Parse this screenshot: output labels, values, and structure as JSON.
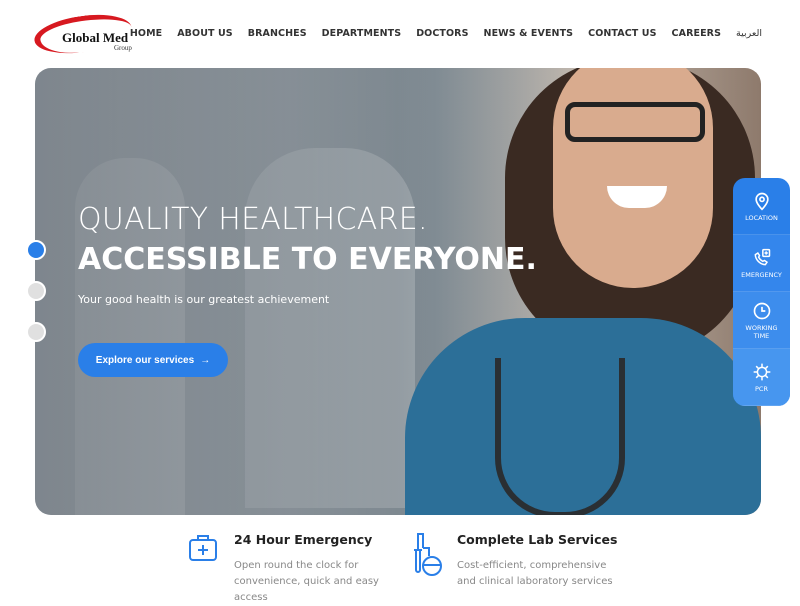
{
  "logo": {
    "name": "Global Med",
    "sub": "Group"
  },
  "nav": [
    "HOME",
    "ABOUT US",
    "BRANCHES",
    "DEPARTMENTS",
    "DOCTORS",
    "NEWS & EVENTS",
    "CONTACT US",
    "CAREERS",
    "العربية"
  ],
  "hero": {
    "line1": "QUALITY HEALTHCARE.",
    "line2": "ACCESSIBLE TO EVERYONE.",
    "subtitle": "Your good health is our greatest achievement",
    "cta": "Explore our services",
    "cta_icon": "→",
    "active_slide": 1,
    "slides": 3
  },
  "side": [
    {
      "icon": "location-pin",
      "label": "LOCATION"
    },
    {
      "icon": "phone-plus",
      "label": "EMERGENCY"
    },
    {
      "icon": "clock",
      "label": "WORKING TIME"
    },
    {
      "icon": "virus",
      "label": "PCR"
    }
  ],
  "features": [
    {
      "icon": "first-aid-kit",
      "title": "24 Hour Emergency",
      "text": "Open round the clock for convenience, quick and easy access"
    },
    {
      "icon": "lab-flask",
      "title": "Complete Lab Services",
      "text": "Cost-efficient, comprehensive and clinical laboratory services"
    }
  ],
  "colors": {
    "accent": "#2a7fe8",
    "logo_red": "#d71920"
  }
}
